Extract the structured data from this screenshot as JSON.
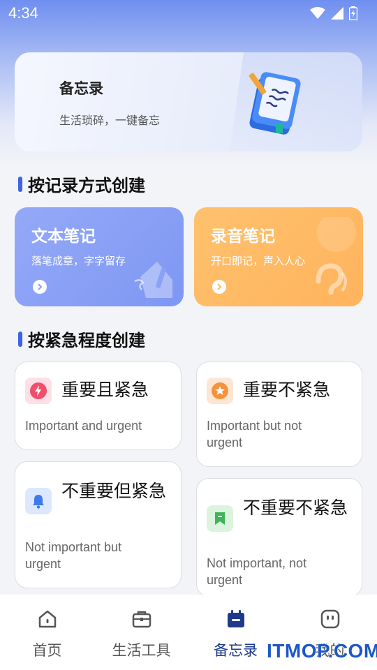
{
  "status_bar": {
    "time": "4:34",
    "wifi_icon": "wifi-icon",
    "signal_icon": "signal-icon",
    "battery_icon": "battery-icon"
  },
  "banner": {
    "title": "备忘录",
    "subtitle": "生活琐碎，一键备忘",
    "icon": "notebook-illustration"
  },
  "section_mode": {
    "title": "按记录方式创建"
  },
  "mode_cards": [
    {
      "title": "文本笔记",
      "subtitle": "落笔成章，字字留存",
      "color": "#8aa1f5",
      "icon": "pen-illustration"
    },
    {
      "title": "录音笔记",
      "subtitle": "开口即记，声入人心",
      "color": "#ffb964",
      "icon": "ear-illustration"
    }
  ],
  "section_urgency": {
    "title": "按紧急程度创建"
  },
  "urgency_cards": [
    {
      "title": "重要且紧急",
      "desc": "Important and urgent",
      "icon": "lightning-icon",
      "color": "#f04e6b"
    },
    {
      "title": "重要不紧急",
      "desc": "Important but not urgent",
      "icon": "star-icon",
      "color": "#f6923a"
    },
    {
      "title": "不重要但紧急",
      "desc": "Not important but urgent",
      "icon": "bell-icon",
      "color": "#3d7be8"
    },
    {
      "title": "不重要不紧急",
      "desc": "Not important, not urgent",
      "icon": "bookmark-icon",
      "color": "#3fb55a"
    }
  ],
  "nav": {
    "items": [
      {
        "label": "首页",
        "icon": "home-icon"
      },
      {
        "label": "生活工具",
        "icon": "toolbox-icon"
      },
      {
        "label": "备忘录",
        "icon": "calendar-icon",
        "active": true
      },
      {
        "label": "我的",
        "icon": "profile-icon"
      }
    ]
  },
  "watermark": "ITMOP.COM",
  "colors": {
    "accent": "#3d63ea",
    "active_nav": "#1f3a8a"
  }
}
